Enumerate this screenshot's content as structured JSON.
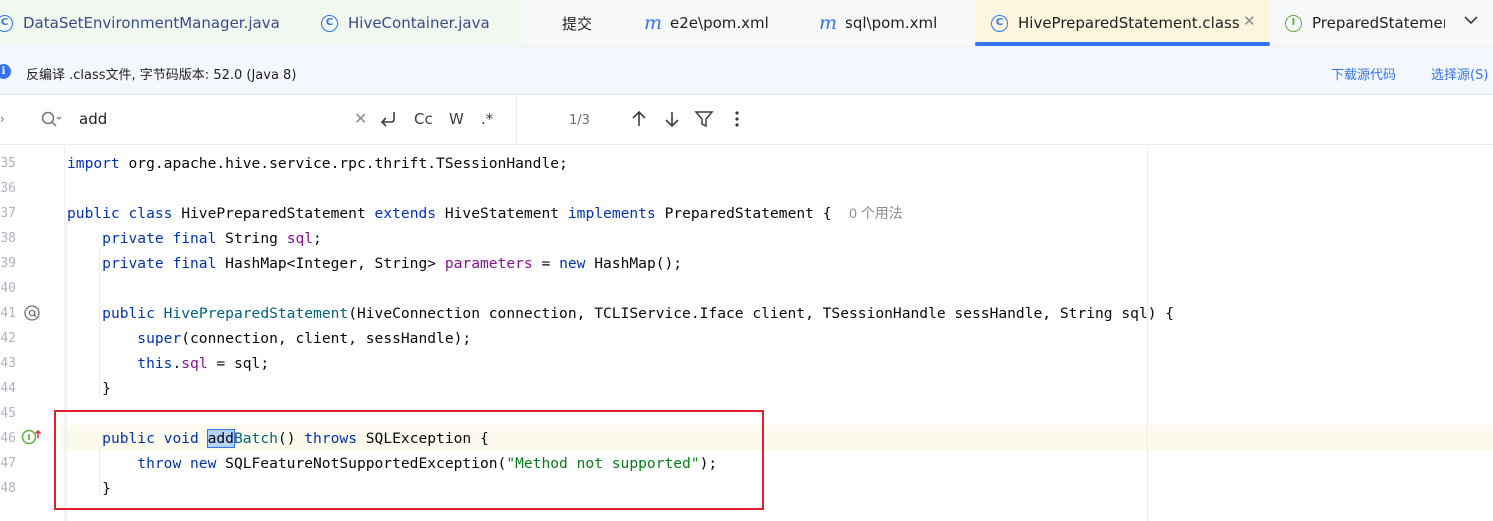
{
  "tabs": [
    {
      "label": "DataSetEnvironmentManager.java",
      "icon": "class-icon"
    },
    {
      "label": "HiveContainer.java",
      "icon": "class-icon"
    },
    {
      "label": "提交",
      "icon": ""
    },
    {
      "label": "e2e\\pom.xml",
      "icon": "maven-icon"
    },
    {
      "label": "sql\\pom.xml",
      "icon": "maven-icon"
    },
    {
      "label": "HivePreparedStatement.class",
      "icon": "class-icon",
      "active": true
    },
    {
      "label": "PreparedStatement",
      "icon": "interface-icon"
    }
  ],
  "infobar": {
    "text": "反编译 .class文件, 字节码版本: 52.0 (Java 8)",
    "download_link": "下载源代码",
    "choose_link": "选择源(S)"
  },
  "search": {
    "query": "add",
    "match_case_label": "Cc",
    "words_label": "W",
    "regex_label": ".*",
    "match_count": "1/3"
  },
  "editor": {
    "lines": [
      {
        "n": "35",
        "code": "import org.apache.hive.service.rpc.thrift.TSessionHandle;"
      },
      {
        "n": "36",
        "code": ""
      },
      {
        "n": "37",
        "code": "public class HivePreparedStatement extends HiveStatement implements PreparedStatement {",
        "hint": "0 个用法"
      },
      {
        "n": "38",
        "code": "    private final String sql;"
      },
      {
        "n": "39",
        "code": "    private final HashMap<Integer, String> parameters = new HashMap();"
      },
      {
        "n": "40",
        "code": ""
      },
      {
        "n": "41",
        "code": "    public HivePreparedStatement(HiveConnection connection, TCLIService.Iface client, TSessionHandle sessHandle, String sql) {"
      },
      {
        "n": "42",
        "code": "        super(connection, client, sessHandle);"
      },
      {
        "n": "43",
        "code": "        this.sql = sql;"
      },
      {
        "n": "44",
        "code": "    }"
      },
      {
        "n": "45",
        "code": ""
      },
      {
        "n": "46",
        "code": "    public void addBatch() throws SQLException {"
      },
      {
        "n": "47",
        "code": "        throw new SQLFeatureNotSupportedException(\"Method not supported\");"
      },
      {
        "n": "48",
        "code": "    }"
      }
    ]
  },
  "colors": {
    "keyword": "#0033b3",
    "field": "#871094",
    "string": "#067d17",
    "accent": "#3574f0",
    "annotation_box": "#e0202c"
  }
}
